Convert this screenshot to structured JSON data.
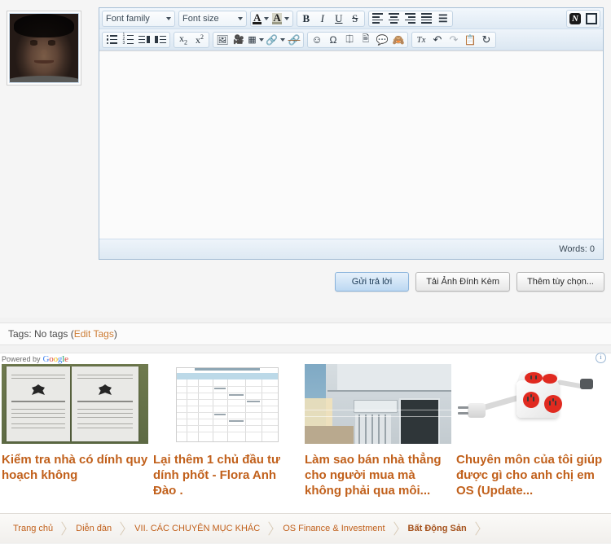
{
  "editor": {
    "font_family_label": "Font family",
    "font_size_label": "Font size",
    "words_label": "Words: 0",
    "content": "",
    "toolbar_row1": [
      {
        "name": "font-family-select",
        "label": "Font family"
      },
      {
        "name": "font-size-select",
        "label": "Font size"
      },
      {
        "name": "text-color-button",
        "label": "A"
      },
      {
        "name": "background-color-button",
        "label": "A"
      },
      {
        "name": "bold-button",
        "label": "B"
      },
      {
        "name": "italic-button",
        "label": "I"
      },
      {
        "name": "underline-button",
        "label": "U"
      },
      {
        "name": "strikethrough-button",
        "label": "S"
      },
      {
        "name": "align-left-button",
        "label": ""
      },
      {
        "name": "align-center-button",
        "label": ""
      },
      {
        "name": "align-right-button",
        "label": ""
      },
      {
        "name": "align-justify-button",
        "label": ""
      },
      {
        "name": "horizontal-rule-button",
        "label": ""
      },
      {
        "name": "tinymce-logo-button",
        "label": "N"
      },
      {
        "name": "fullscreen-button",
        "label": ""
      }
    ],
    "toolbar_row2": [
      {
        "name": "bullet-list-button",
        "label": ""
      },
      {
        "name": "numbered-list-button",
        "label": ""
      },
      {
        "name": "outdent-button",
        "label": ""
      },
      {
        "name": "indent-button",
        "label": ""
      },
      {
        "name": "subscript-button",
        "label": "x"
      },
      {
        "name": "superscript-button",
        "label": "x"
      },
      {
        "name": "insert-image-button",
        "label": ""
      },
      {
        "name": "insert-video-button",
        "label": ""
      },
      {
        "name": "insert-table-button",
        "label": ""
      },
      {
        "name": "insert-link-button",
        "label": ""
      },
      {
        "name": "unlink-button",
        "label": ""
      },
      {
        "name": "smilies-button",
        "label": "☺"
      },
      {
        "name": "special-character-button",
        "label": "Ω"
      },
      {
        "name": "attach-button",
        "label": ""
      },
      {
        "name": "insert-code-button",
        "label": ""
      },
      {
        "name": "quote-button",
        "label": ""
      },
      {
        "name": "spoiler-button",
        "label": ""
      },
      {
        "name": "remove-formatting-button",
        "label": "Tx"
      },
      {
        "name": "undo-button",
        "label": ""
      },
      {
        "name": "redo-button",
        "label": ""
      },
      {
        "name": "paste-button",
        "label": ""
      },
      {
        "name": "restore-autosave-button",
        "label": ""
      }
    ]
  },
  "actions": {
    "submit_reply": "Gửi trả lời",
    "upload_attachment": "Tải Ảnh Đính Kèm",
    "more_options": "Thêm tùy chọn..."
  },
  "tags": {
    "prefix": "Tags: No tags (",
    "edit_link": "Edit Tags",
    "suffix": ")"
  },
  "ads": {
    "powered_by": "Powered by",
    "brand": "Google",
    "info_glyph": "i",
    "items": [
      {
        "title": "Kiểm tra nhà có dính quy hoạch không",
        "image": "land-certificates-photo"
      },
      {
        "title": "Lại thêm 1 chủ đầu tư dính phốt - Flora Anh Đào .",
        "image": "spreadsheet-photo"
      },
      {
        "title": "Làm sao bán nhà thẳng cho người mua mà không phải qua môi...",
        "image": "house-facade-photo"
      },
      {
        "title": "Chuyên môn của tôi giúp được gì cho anh chị em OS (Update...",
        "image": "power-cube-photo"
      }
    ]
  },
  "breadcrumb": [
    {
      "label": "Trang chủ"
    },
    {
      "label": "Diễn đàn"
    },
    {
      "label": "VII. CÁC CHUYÊN MỤC KHÁC"
    },
    {
      "label": "OS Finance & Investment"
    },
    {
      "label": "Bất Động Sản"
    }
  ],
  "avatar": {
    "alt": "user-avatar"
  },
  "colors": {
    "accent": "#c1601b",
    "toolbar_top": "#f2f7fc",
    "toolbar_bottom": "#dfeaf4",
    "editor_border": "#a8c0d6"
  }
}
